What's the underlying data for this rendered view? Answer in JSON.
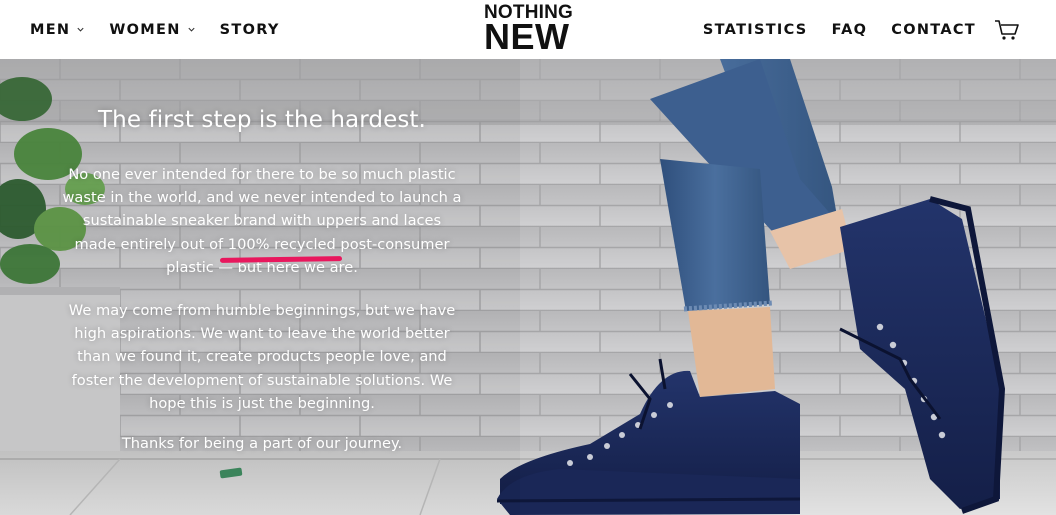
{
  "nav": {
    "left": [
      {
        "label": "MEN",
        "has_dropdown": true
      },
      {
        "label": "WOMEN",
        "has_dropdown": true
      },
      {
        "label": "STORY",
        "has_dropdown": false
      }
    ],
    "right": [
      {
        "label": "STATISTICS"
      },
      {
        "label": "FAQ"
      },
      {
        "label": "CONTACT"
      }
    ],
    "cart_icon": "shopping-cart-icon",
    "dropdown_icon": "chevron-down-icon"
  },
  "logo": {
    "line1": "NOTHING",
    "line2": "NEW"
  },
  "hero": {
    "title": "The first step is the hardest.",
    "p1_before": "No one ever intended for there to be so much plastic waste in the world, and we never intended to launch a sustainable sneaker brand with uppers and laces made entirely out of ",
    "p1_highlight": "100% recycled",
    "p1_after": " post-consumer plastic — but here we are.",
    "p2": "We may come from humble beginnings, but we have high aspirations. We want to leave the world better than we found it, create products people love, and foster the development of sustainable solutions. We hope this is just the beginning.",
    "p3": "Thanks for being a part of our journey.",
    "highlight_color": "#e8175d"
  }
}
